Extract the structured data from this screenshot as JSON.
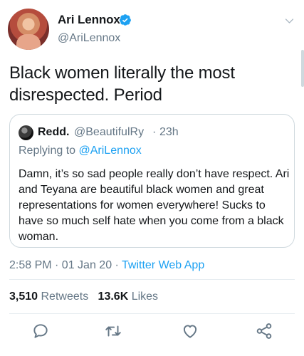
{
  "author": {
    "display_name": "Ari Lennox",
    "handle": "@AriLennox"
  },
  "tweet": {
    "text": "Black women literally the most disrespected. Period"
  },
  "quoted": {
    "display_name": "Redd.",
    "handle": "@BeautifulRy",
    "separator": "·",
    "time": "23h",
    "replying_prefix": "Replying to ",
    "replying_to": "@AriLennox",
    "text": "Damn, it’s so sad people really don’t have respect. Ari and Teyana are beautiful black women and great representations for women everywhere! Sucks to have so much self hate when you come from a black woman."
  },
  "meta": {
    "time": "2:58 PM · 01 Jan 20 · ",
    "source": "Twitter Web App"
  },
  "stats": {
    "retweets_count": "3,510",
    "retweets_label": "Retweets",
    "likes_count": "13.6K",
    "likes_label": "Likes"
  },
  "icons": {
    "verified": "verified-badge-icon",
    "caret": "chevron-down-icon",
    "reply": "reply-icon",
    "retweet": "retweet-icon",
    "like": "heart-icon",
    "share": "share-icon"
  },
  "colors": {
    "accent": "#1da1f2",
    "secondary_text": "#657786",
    "text": "#14171a",
    "border": "#cfd9de"
  }
}
